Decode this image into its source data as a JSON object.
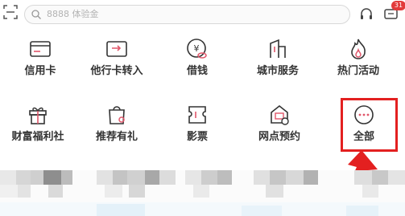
{
  "topbar": {
    "search_placeholder": "8888 体验金",
    "badge_count": "31"
  },
  "grid": {
    "row1": [
      {
        "label": "信用卡",
        "icon": "credit-card-icon"
      },
      {
        "label": "他行卡转入",
        "icon": "card-transfer-icon"
      },
      {
        "label": "借钱",
        "icon": "borrow-money-icon"
      },
      {
        "label": "城市服务",
        "icon": "city-service-icon"
      },
      {
        "label": "热门活动",
        "icon": "flame-icon"
      }
    ],
    "row2": [
      {
        "label": "财富福利社",
        "icon": "gift-icon"
      },
      {
        "label": "推荐有礼",
        "icon": "shopping-bag-icon"
      },
      {
        "label": "影票",
        "icon": "movie-ticket-icon"
      },
      {
        "label": "网点预约",
        "icon": "branch-appointment-icon"
      },
      {
        "label": "全部",
        "icon": "more-icon"
      }
    ]
  },
  "colors": {
    "accent_red": "#e32020",
    "icon_pink": "#e0566a",
    "icon_dark": "#333333"
  }
}
